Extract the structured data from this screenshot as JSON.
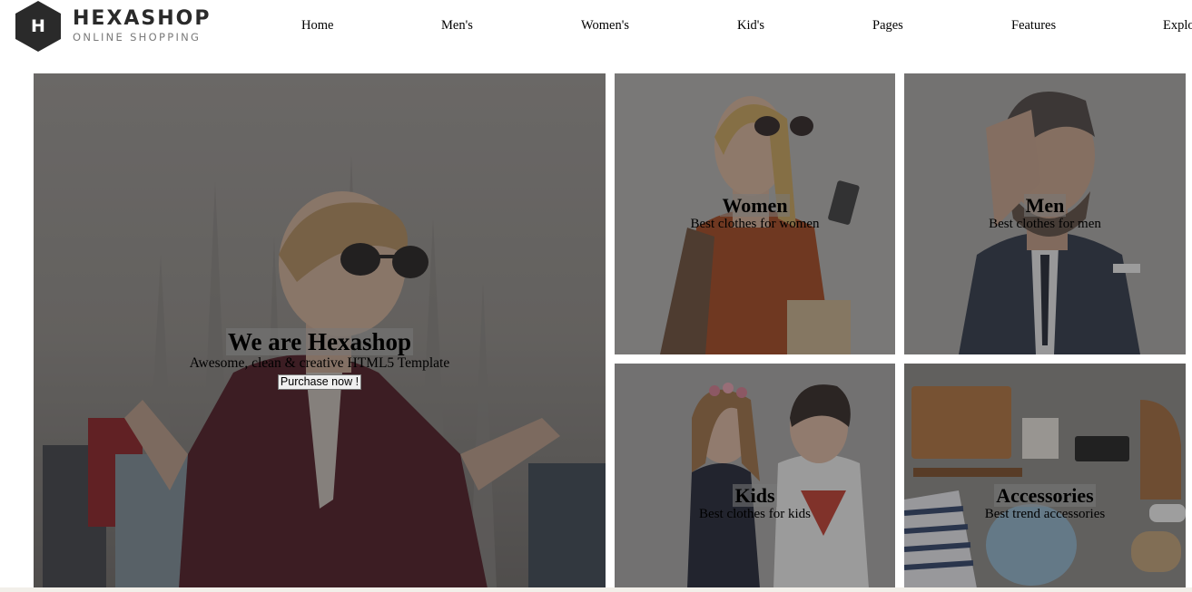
{
  "brand": {
    "letter": "H",
    "name": "HEXASHOP",
    "tagline": "ONLINE SHOPPING",
    "color": "#2a2a2a"
  },
  "nav": {
    "items": [
      "Home",
      "Men's",
      "Women's",
      "Kid's",
      "Pages",
      "Features",
      "Explore"
    ]
  },
  "hero": {
    "title": "We are Hexashop",
    "subtitle": "Awesome, clean & creative HTML5 Template",
    "button": "Purchase now !"
  },
  "categories": [
    {
      "title": "Women",
      "subtitle": "Best clothes for women"
    },
    {
      "title": "Men",
      "subtitle": "Best clothes for men"
    },
    {
      "title": "Kids",
      "subtitle": "Best clothes for kids"
    },
    {
      "title": "Accessories",
      "subtitle": "Best trend accessories"
    }
  ]
}
